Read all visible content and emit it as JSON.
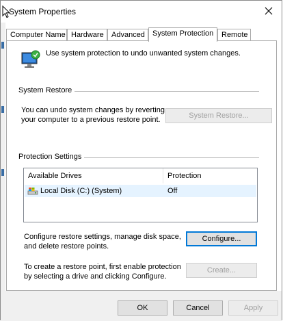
{
  "window": {
    "title": "System Properties"
  },
  "tabs": [
    {
      "label": "Computer Name"
    },
    {
      "label": "Hardware"
    },
    {
      "label": "Advanced"
    },
    {
      "label": "System Protection"
    },
    {
      "label": "Remote"
    }
  ],
  "active_tab": "System Protection",
  "intro": {
    "text": "Use system protection to undo unwanted system changes."
  },
  "system_restore": {
    "heading": "System Restore",
    "description_line1": "You can undo system changes by reverting",
    "description_line2": "your computer to a previous restore point.",
    "button_label": "System Restore..."
  },
  "protection_settings": {
    "heading": "Protection Settings",
    "columns": [
      "Available Drives",
      "Protection"
    ],
    "drives": [
      {
        "name": "Local Disk (C:) (System)",
        "protection": "Off",
        "icon": "hard-drive-icon"
      }
    ]
  },
  "configure": {
    "line1": "Configure restore settings, manage disk space,",
    "line2": "and delete restore points.",
    "button_label": "Configure..."
  },
  "create": {
    "line1": "To create a restore point, first enable protection",
    "line2": "by selecting a drive and clicking Configure.",
    "button_label": "Create..."
  },
  "footer": {
    "ok_label": "OK",
    "cancel_label": "Cancel",
    "apply_label": "Apply"
  },
  "colors": {
    "focus_border": "#0078d7",
    "selected_row": "#e5f3ff"
  }
}
